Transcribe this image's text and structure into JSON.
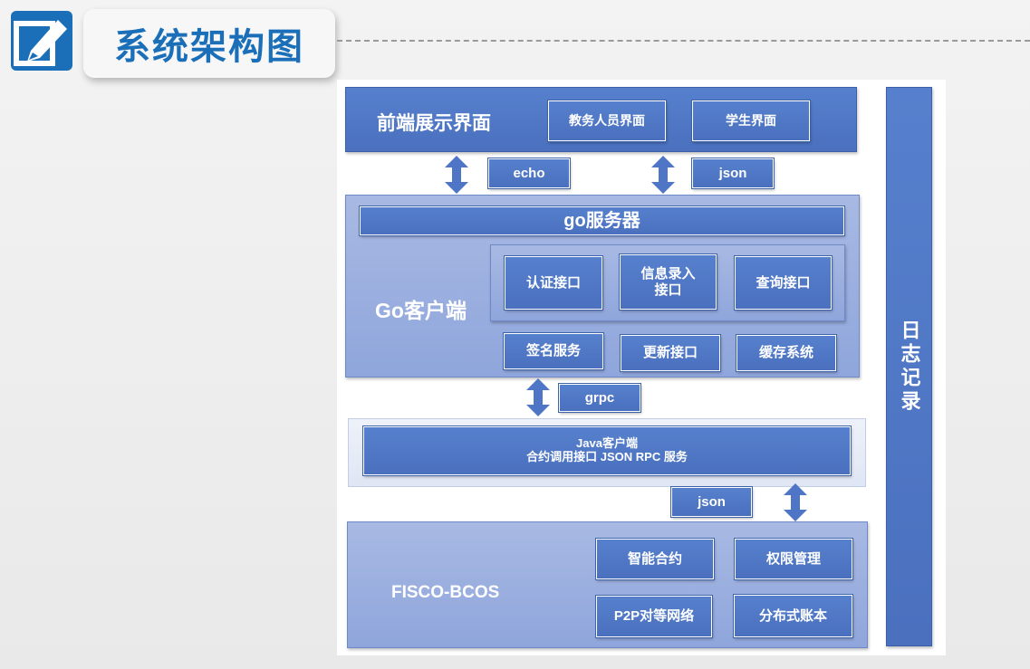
{
  "title": "系统架构图",
  "icon": "edit-pencil-icon",
  "colors": {
    "brand": "#1a6fb8",
    "layer": "#4f76c6",
    "layer_light": "#9fb3e0"
  },
  "frontend": {
    "label": "前端展示界面",
    "buttons": [
      "教务人员界面",
      "学生界面"
    ]
  },
  "connectors": {
    "echo": "echo",
    "json_top": "json",
    "grpc": "grpc",
    "json_bottom": "json"
  },
  "go_client": {
    "server_bar": "go服务器",
    "label": "Go客户端",
    "interfaces_top": [
      "认证接口",
      "信息录入\n接口",
      "查询接口"
    ],
    "interfaces_bottom": [
      "签名服务",
      "更新接口",
      "缓存系统"
    ]
  },
  "java_client": {
    "line1": "Java客户端",
    "line2": "合约调用接口 JSON RPC 服务"
  },
  "fisco": {
    "label": "FISCO-BCOS",
    "buttons": [
      "智能合约",
      "权限管理",
      "P2P对等网络",
      "分布式账本"
    ]
  },
  "log": {
    "label": "日志记录"
  }
}
